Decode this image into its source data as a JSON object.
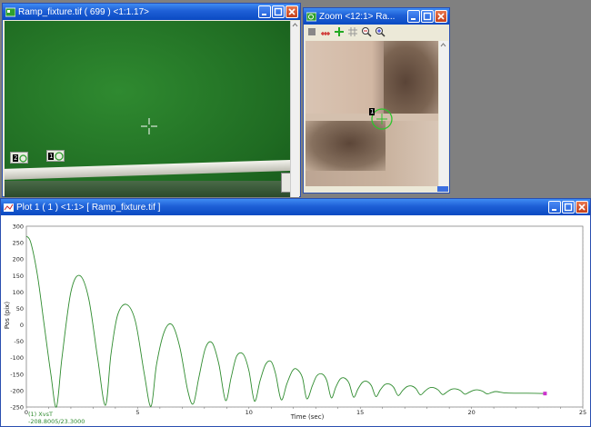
{
  "video_window": {
    "title": "Ramp_fixture.tif ( 699 ) <1:1.17>",
    "markers": [
      "2",
      "1"
    ]
  },
  "zoom_window": {
    "title": "Zoom <12:1> Ra...",
    "marker": "1"
  },
  "plot_window": {
    "title": "Plot 1 ( 1 ) <1:1> [ Ramp_fixture.tif ]",
    "legend_series": "(1) XvsT",
    "cursor_readout": "-208.8005/23.3000"
  },
  "colors": {
    "curve": "#2e8b2e",
    "endpoint": "#cc33cc",
    "title_blue": "#0a4ac2"
  },
  "chart_data": {
    "type": "line",
    "xlabel": "Time (sec)",
    "ylabel": "Pos (pix)",
    "xlim": [
      0,
      25
    ],
    "ylim": [
      -250,
      300
    ],
    "xticks": [
      "0",
      "5",
      "10",
      "15",
      "20",
      "25"
    ],
    "yticks": [
      "300",
      "250",
      "200",
      "150",
      "100",
      "50",
      "0",
      "-50",
      "-100",
      "-150",
      "-200",
      "-250"
    ],
    "grid": true,
    "series": [
      {
        "x": [
          0,
          0.2,
          0.5,
          0.8,
          1.1,
          1.35,
          1.6,
          2.0,
          2.4,
          2.8,
          3.2,
          3.55,
          3.8,
          4.1,
          4.5,
          4.9,
          5.3,
          5.6,
          5.85,
          6.2,
          6.55,
          6.9,
          7.25,
          7.5,
          7.75,
          8.05,
          8.35,
          8.65,
          8.95,
          9.2,
          9.45,
          9.75,
          10.0,
          10.25,
          10.5,
          10.75,
          11.0,
          11.2,
          11.45,
          11.7,
          11.95,
          12.15,
          12.4,
          12.6,
          12.85,
          13.05,
          13.3,
          13.5,
          13.7,
          13.9,
          14.1,
          14.3,
          14.5,
          14.7,
          14.9,
          15.1,
          15.3,
          15.5,
          15.7,
          15.9,
          16.1,
          16.3,
          16.5,
          16.7,
          16.9,
          17.1,
          17.3,
          17.5,
          17.7,
          17.9,
          18.1,
          18.3,
          18.5,
          18.7,
          18.9,
          19.1,
          19.3,
          19.5,
          19.7,
          19.9,
          20.1,
          20.3,
          20.5,
          20.7,
          20.9,
          21.1,
          21.5,
          22.0,
          22.5,
          23.3
        ],
        "y": [
          270,
          250,
          150,
          0,
          -150,
          -250,
          -100,
          100,
          150,
          80,
          -100,
          -245,
          -90,
          30,
          62,
          10,
          -150,
          -248,
          -120,
          -20,
          0,
          -70,
          -200,
          -240,
          -160,
          -70,
          -55,
          -120,
          -230,
          -160,
          -95,
          -90,
          -140,
          -232,
          -170,
          -120,
          -112,
          -150,
          -228,
          -180,
          -140,
          -135,
          -160,
          -225,
          -185,
          -155,
          -150,
          -170,
          -222,
          -190,
          -165,
          -162,
          -178,
          -220,
          -195,
          -175,
          -172,
          -185,
          -218,
          -198,
          -182,
          -180,
          -190,
          -215,
          -200,
          -188,
          -186,
          -194,
          -213,
          -202,
          -192,
          -191,
          -198,
          -212,
          -204,
          -196,
          -195,
          -200,
          -211,
          -205,
          -199,
          -198,
          -202,
          -210,
          -206,
          -203,
          -207,
          -208,
          -208,
          -209
        ]
      }
    ]
  }
}
